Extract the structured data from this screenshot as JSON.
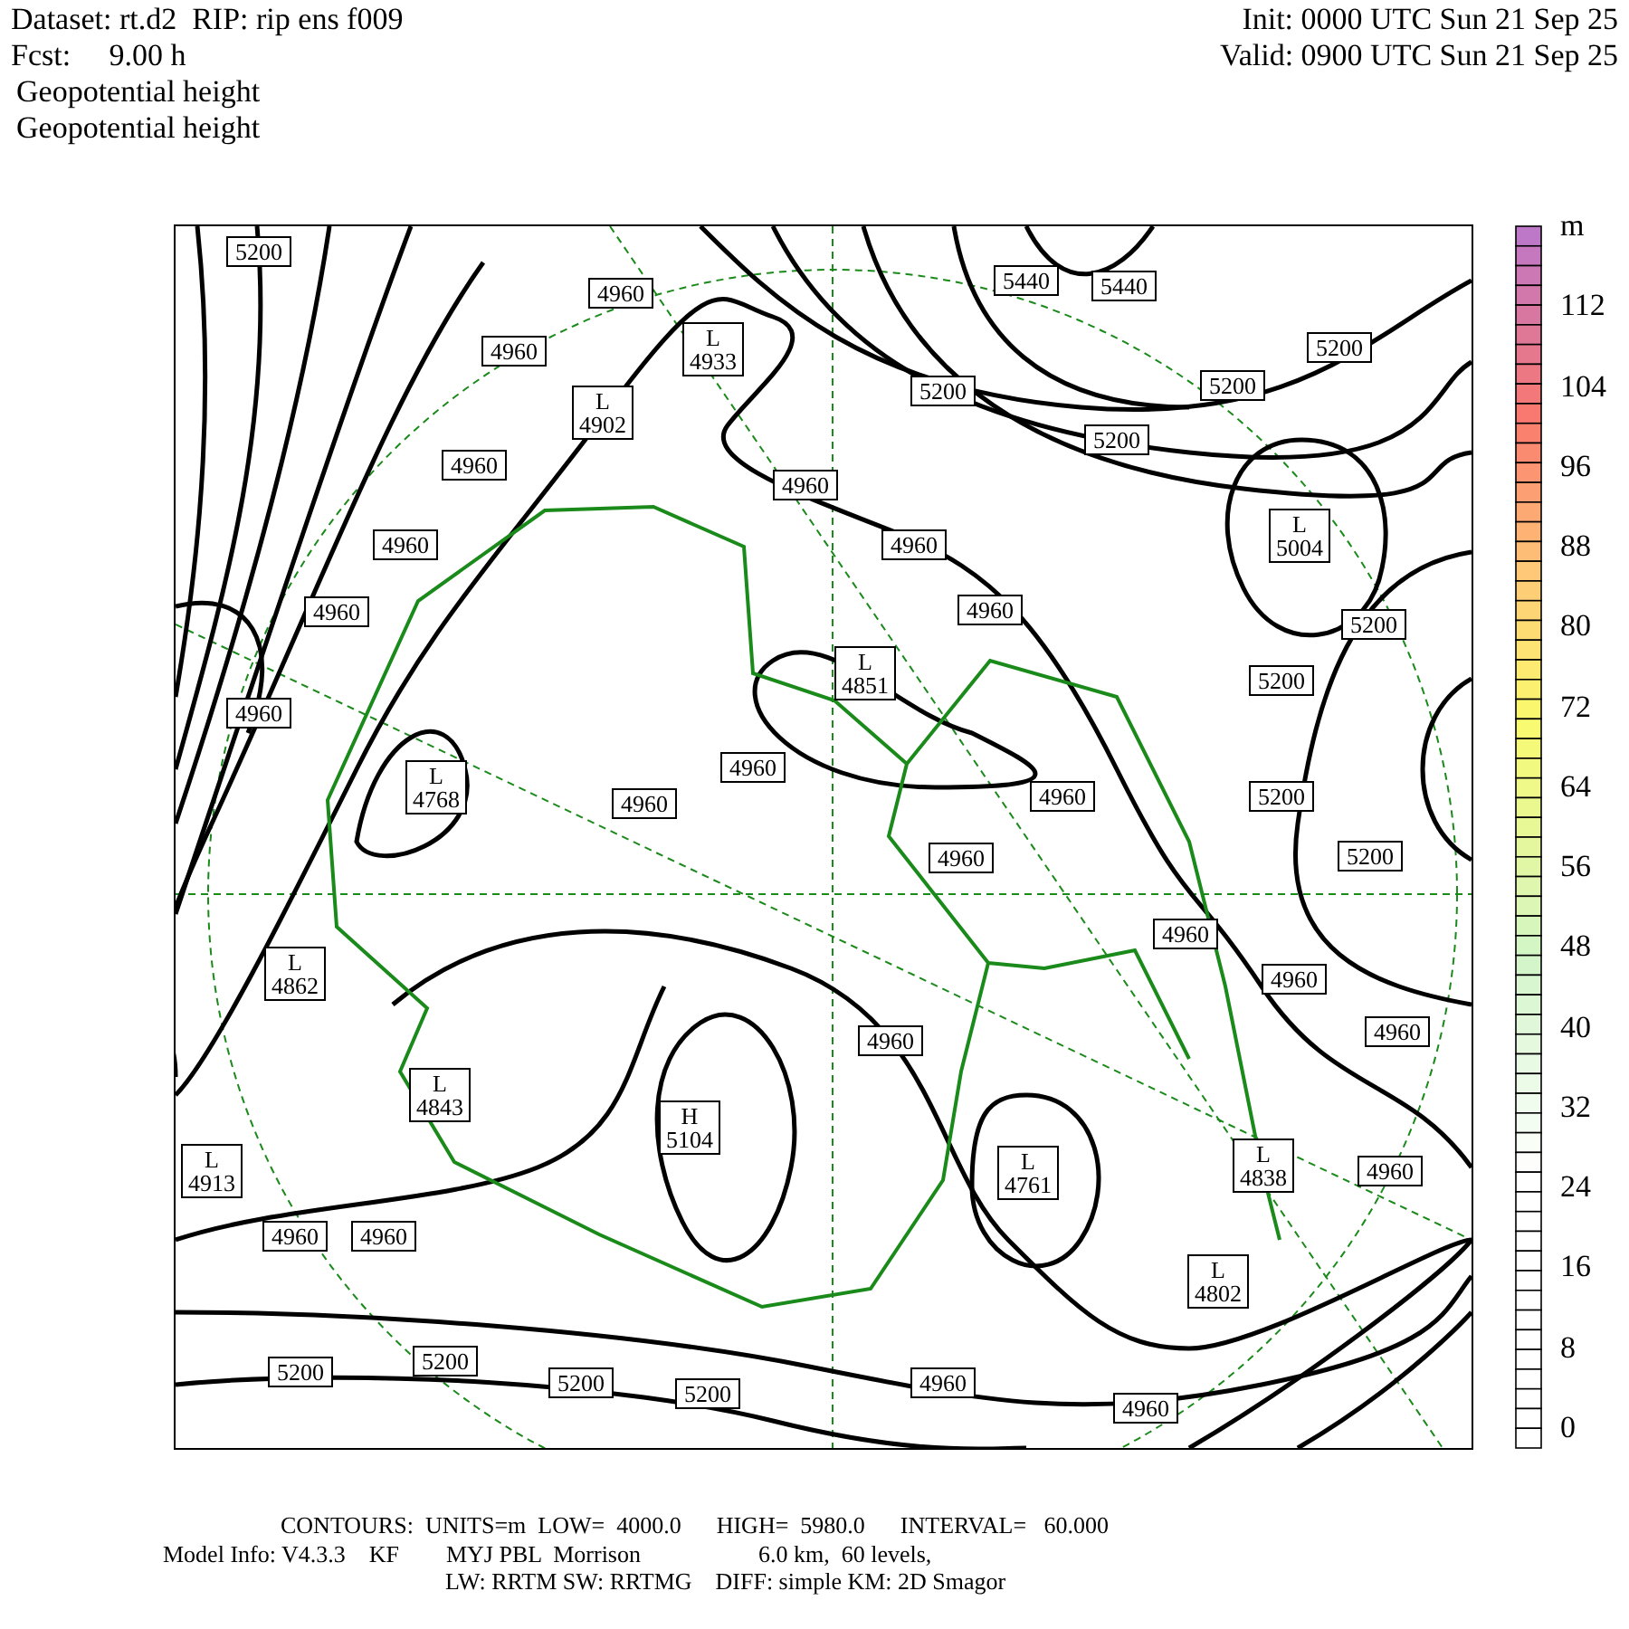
{
  "header": {
    "left": [
      "Dataset: rt.d2  RIP: rip ens f009",
      "Fcst:     9.00 h"
    ],
    "right": [
      "Init: 0000 UTC Sun 21 Sep 25",
      "Valid: 0900 UTC Sun 21 Sep 25"
    ],
    "fields": [
      "Geopotential height",
      "Geopotential height"
    ]
  },
  "map": {
    "labels": [
      {
        "kind": "contour",
        "value": "5200"
      },
      {
        "kind": "contour",
        "value": "4960"
      },
      {
        "kind": "contour",
        "value": "5440"
      },
      {
        "kind": "contour",
        "value": "5440"
      },
      {
        "kind": "contour",
        "value": "4960"
      },
      {
        "kind": "low",
        "letter": "L",
        "value": "4933"
      },
      {
        "kind": "contour",
        "value": "5200"
      },
      {
        "kind": "low",
        "letter": "L",
        "value": "4902"
      },
      {
        "kind": "contour",
        "value": "5200"
      },
      {
        "kind": "contour",
        "value": "5200"
      },
      {
        "kind": "contour",
        "value": "5200"
      },
      {
        "kind": "contour",
        "value": "4960"
      },
      {
        "kind": "contour",
        "value": "4960"
      },
      {
        "kind": "contour",
        "value": "4960"
      },
      {
        "kind": "contour",
        "value": "4960"
      },
      {
        "kind": "low",
        "letter": "L",
        "value": "5004"
      },
      {
        "kind": "contour",
        "value": "4960"
      },
      {
        "kind": "contour",
        "value": "4960"
      },
      {
        "kind": "contour",
        "value": "5200"
      },
      {
        "kind": "low",
        "letter": "L",
        "value": "4851"
      },
      {
        "kind": "contour",
        "value": "5200"
      },
      {
        "kind": "contour",
        "value": "4960"
      },
      {
        "kind": "low",
        "letter": "L",
        "value": "4768"
      },
      {
        "kind": "contour",
        "value": "4960"
      },
      {
        "kind": "contour",
        "value": "4960"
      },
      {
        "kind": "contour",
        "value": "4960"
      },
      {
        "kind": "contour",
        "value": "5200"
      },
      {
        "kind": "contour",
        "value": "4960"
      },
      {
        "kind": "contour",
        "value": "5200"
      },
      {
        "kind": "contour",
        "value": "4960"
      },
      {
        "kind": "low",
        "letter": "L",
        "value": "4862"
      },
      {
        "kind": "contour",
        "value": "4960"
      },
      {
        "kind": "contour",
        "value": "4960"
      },
      {
        "kind": "contour",
        "value": "4960"
      },
      {
        "kind": "low",
        "letter": "L",
        "value": "4843"
      },
      {
        "kind": "high",
        "letter": "H",
        "value": "5104"
      },
      {
        "kind": "low",
        "letter": "L",
        "value": "4913"
      },
      {
        "kind": "low",
        "letter": "L",
        "value": "4761"
      },
      {
        "kind": "low",
        "letter": "L",
        "value": "4838"
      },
      {
        "kind": "contour",
        "value": "4960"
      },
      {
        "kind": "contour",
        "value": "4960"
      },
      {
        "kind": "contour",
        "value": "4960"
      },
      {
        "kind": "low",
        "letter": "L",
        "value": "4802"
      },
      {
        "kind": "contour",
        "value": "5200"
      },
      {
        "kind": "contour",
        "value": "5200"
      },
      {
        "kind": "contour",
        "value": "5200"
      },
      {
        "kind": "contour",
        "value": "5200"
      },
      {
        "kind": "contour",
        "value": "4960"
      },
      {
        "kind": "contour",
        "value": "4960"
      }
    ]
  },
  "colorbar": {
    "unit": "m",
    "labels": [
      "112",
      "104",
      "96",
      "88",
      "80",
      "72",
      "64",
      "56",
      "48",
      "40",
      "32",
      "24",
      "16",
      "8",
      "0"
    ]
  },
  "footer": [
    "CONTOURS:  UNITS=m  LOW=  4000.0      HIGH=  5980.0      INTERVAL=   60.000",
    "Model Info: V4.3.3    KF        MYJ PBL  Morrison                    6.0 km,  60 levels,",
    "LW: RRTM SW: RRTMG    DIFF: simple KM: 2D Smagor"
  ]
}
